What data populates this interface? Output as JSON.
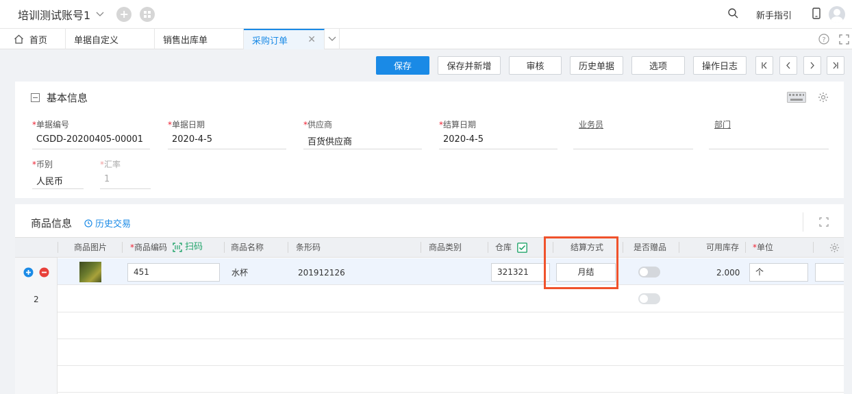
{
  "topbar": {
    "account": "培训测试账号1",
    "guide": "新手指引"
  },
  "tabs": [
    {
      "label": "首页"
    },
    {
      "label": "单据自定义"
    },
    {
      "label": "销售出库单"
    },
    {
      "label": "采购订单"
    }
  ],
  "toolbar": {
    "save": "保存",
    "save_new": "保存并新增",
    "audit": "审核",
    "history": "历史单据",
    "options": "选项",
    "log": "操作日志"
  },
  "basic": {
    "title": "基本信息",
    "fields": {
      "doc_no": {
        "label": "单据编号",
        "value": "CGDD-20200405-00001"
      },
      "doc_date": {
        "label": "单据日期",
        "value": "2020-4-5"
      },
      "supplier": {
        "label": "供应商",
        "value": "百货供应商"
      },
      "settle_date": {
        "label": "结算日期",
        "value": "2020-4-5"
      },
      "salesman": {
        "label": "业务员",
        "value": ""
      },
      "dept": {
        "label": "部门",
        "value": ""
      },
      "currency": {
        "label": "币别",
        "value": "人民币"
      },
      "rate": {
        "label": "汇率",
        "value": "1"
      }
    }
  },
  "goods": {
    "title": "商品信息",
    "history_link": "历史交易",
    "columns": {
      "image": "商品图片",
      "code": "商品编码",
      "scan": "扫码",
      "name": "商品名称",
      "barcode": "条形码",
      "category": "商品类别",
      "warehouse": "仓库",
      "settle": "结算方式",
      "gift": "是否赠品",
      "stock": "可用库存",
      "unit": "单位"
    },
    "rows": [
      {
        "code": "451",
        "name": "水杯",
        "barcode": "201912126",
        "warehouse": "321321",
        "settle": "月结",
        "stock": "2.000",
        "unit": "个"
      },
      {
        "num": "2"
      }
    ]
  },
  "colors": {
    "accent": "#1a8ae6",
    "highlight": "#f0522b",
    "add": "#1a8ae6",
    "remove": "#e8403a"
  }
}
